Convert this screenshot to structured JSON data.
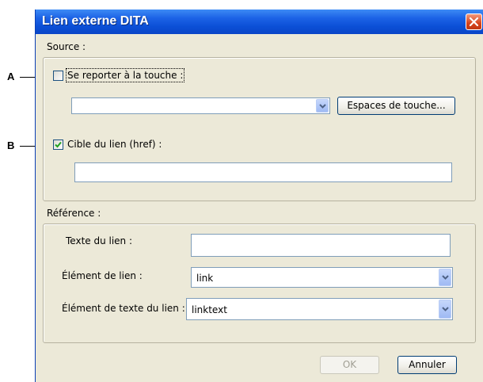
{
  "window": {
    "title": "Lien externe DITA"
  },
  "callouts": {
    "a": "A",
    "b": "B"
  },
  "source": {
    "label": "Source :",
    "key_ref": {
      "label": "Se reporter à la touche :",
      "checked": false,
      "combo_value": "",
      "key_spaces_button": "Espaces de touche..."
    },
    "href": {
      "label": "Cible du lien (href) :",
      "checked": true,
      "value": ""
    }
  },
  "reference": {
    "label": "Référence :",
    "link_text": {
      "label": "Texte du lien :",
      "value": ""
    },
    "link_element": {
      "label": "Élément de lien :",
      "value": "link"
    },
    "link_text_element": {
      "label": "Élément de texte du lien :",
      "value": "linktext"
    }
  },
  "buttons": {
    "ok": "OK",
    "cancel": "Annuler"
  },
  "icons": {
    "close": "close-icon",
    "check": "checkmark-icon",
    "dropdown": "chevron-down-icon"
  }
}
